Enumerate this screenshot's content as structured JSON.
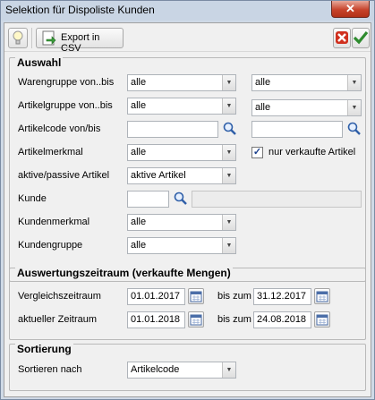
{
  "window": {
    "title": "Selektion für Dispoliste Kunden",
    "close_glyph": "✕"
  },
  "toolbar": {
    "csv_label": "Export in CSV"
  },
  "auswahl": {
    "title": "Auswahl",
    "warengruppe": {
      "label": "Warengruppe von..bis",
      "from": "alle",
      "to": "alle"
    },
    "artikelgruppe": {
      "label": "Artikelgruppe von..bis",
      "from": "alle",
      "to": "alle"
    },
    "artikelcode": {
      "label": "Artikelcode von/bis",
      "from": "",
      "to": ""
    },
    "artikelmerkmal": {
      "label": "Artikelmerkmal",
      "value": "alle"
    },
    "nur_verkaufte": {
      "label": "nur verkaufte Artikel",
      "checked": true
    },
    "aktiv_passiv": {
      "label": "aktive/passive Artikel",
      "value": "aktive Artikel"
    },
    "kunde": {
      "label": "Kunde",
      "value": "",
      "name": ""
    },
    "kundenmerkmal": {
      "label": "Kundenmerkmal",
      "value": "alle"
    },
    "kundengruppe": {
      "label": "Kundengruppe",
      "value": "alle"
    }
  },
  "zeitraum": {
    "title": "Auswertungszeitraum (verkaufte Mengen)",
    "vergleich": {
      "label": "Vergleichszeitraum",
      "from": "01.01.2017",
      "bis_label": "bis zum",
      "to": "31.12.2017"
    },
    "aktuell": {
      "label": "aktueller Zeitraum",
      "from": "01.01.2018",
      "bis_label": "bis zum",
      "to": "24.08.2018"
    }
  },
  "sortierung": {
    "title": "Sortierung",
    "sortieren": {
      "label": "Sortieren nach",
      "value": "Artikelcode"
    }
  },
  "colors": {
    "accent_check": "#2e8b2e",
    "cancel_red": "#d0301e",
    "titlebar": "#c9d5e4",
    "client_bg": "#f0f0f0"
  },
  "icons": [
    "lightbulb-icon",
    "export-csv-icon",
    "cancel-icon",
    "ok-icon",
    "search-icon",
    "calendar-icon",
    "close-icon",
    "dropdown-arrow-icon"
  ]
}
